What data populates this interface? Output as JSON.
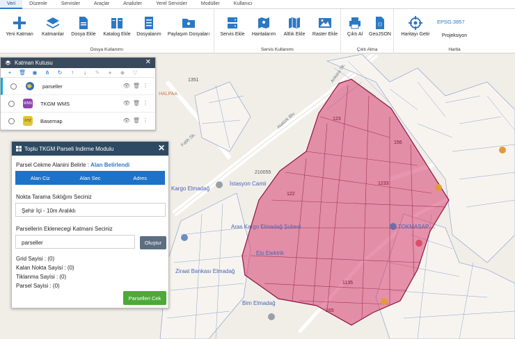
{
  "menu": {
    "tabs": [
      "Veri",
      "Düzenle",
      "Servisler",
      "Araçlar",
      "Analizler",
      "Yerel Servisler",
      "Modüller",
      "Kullanıcı"
    ],
    "active": "Veri"
  },
  "ribbon": {
    "groups": {
      "dosya": {
        "label": "Dosya Kullanımı",
        "buttons": [
          "Yeni Katman",
          "Katmanlar",
          "Dosya Ekle",
          "Katalog Ekle",
          "Dosyalarım",
          "Paylaşım Dosyaları"
        ]
      },
      "servis": {
        "label": "Servis Kullanımı",
        "buttons": [
          "Servis Ekle",
          "Haritalarım",
          "Altlık Ekle",
          "Raster Ekle"
        ]
      },
      "cikti": {
        "label": "Çıktı Alma",
        "buttons": [
          "Çıktı Al",
          "GeoJSON"
        ]
      },
      "harita": {
        "label": "Harita",
        "buttons": [
          "Haritayı Getir",
          "Projeksiyon"
        ],
        "epsg": "EPSG:3857"
      }
    }
  },
  "layer_box": {
    "title": "Katman Kutusu",
    "layers": [
      {
        "name": "parseller",
        "icon": "globe-layer-icon",
        "color": "#3a6db5"
      },
      {
        "name": "TKGM WMS",
        "icon": "wms-icon",
        "color": "#8e44ad",
        "badge": "WMS"
      },
      {
        "name": "Basemap",
        "icon": "xyz-icon",
        "color": "#e2c43a",
        "badge": "XYZ"
      }
    ]
  },
  "module": {
    "title": "Toplu TKGM Parseli Indirme Modulu",
    "area_label": "Parsel Cekme Alanini Belirle :",
    "area_link": "Alan Belirlendi",
    "area_buttons": [
      "Alan Ciz",
      "Alan Sec",
      "Adres"
    ],
    "scan_label": "Nokta Tarama Sıklığını Seciniz",
    "scan_value": "Şehir İçi - 10m Aralıklı",
    "target_label": "Parsellerin Eklenecegi Katmani Seciniz",
    "target_value": "parseller",
    "create_button": "Oluştur",
    "stats": [
      "Grid Sayisi : (0)",
      "Kalan Nokta Sayisi : (0)",
      "Tiklanma Sayisi : (0)",
      "Parsel Sayisi : (0)"
    ],
    "download_button": "Parselleri Cek"
  },
  "map": {
    "labels": {
      "number_1351": "1351",
      "halpaa": "HALPAA",
      "istasyon": "İstasyon Camii",
      "kargo": "Kargo Elmadağ",
      "kargo2": "Aras Kargo Elmadağ Şubesi",
      "tokmasap": "TOKMASAP",
      "elo": "Elo Elektrik",
      "ziraat": "Ziraat Bankası Elmadağ",
      "bim": "Bim Elmadağ",
      "n210055": "210055",
      "n122": "122",
      "n156": "156",
      "n1233": "1233",
      "n123": "123",
      "n1135": "1135",
      "n165": "165",
      "ataturk": "Atatürk Blv.",
      "ankara": "Ankara Sk.",
      "road1": "Fatih Sk."
    },
    "selection_color": "#d6406f"
  },
  "colors": {
    "accent": "#2b78c5",
    "header_dark": "#394a5c",
    "module_header": "#2e4a62",
    "green": "#4caa38"
  }
}
